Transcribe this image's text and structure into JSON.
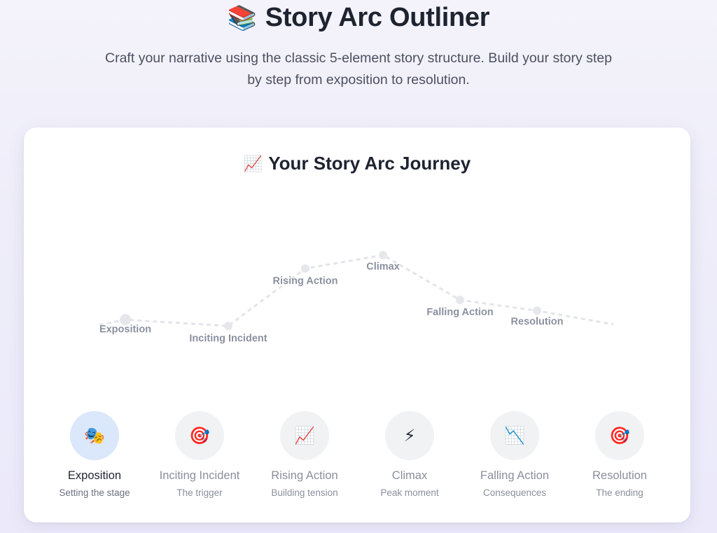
{
  "header": {
    "icon": "books-icon",
    "icon_glyph": "📚",
    "title": "Story Arc Outliner",
    "subtitle": "Craft your narrative using the classic 5-element story structure. Build your story step by step from exposition to resolution."
  },
  "journey": {
    "icon_glyph": "📈",
    "title": "Your Story Arc Journey"
  },
  "arc_points": [
    {
      "label": "Exposition",
      "tension": 0.2
    },
    {
      "label": "Inciting Incident",
      "tension": 0.13
    },
    {
      "label": "Rising Action",
      "tension": 0.77
    },
    {
      "label": "Climax",
      "tension": 0.92
    },
    {
      "label": "Falling Action",
      "tension": 0.42
    },
    {
      "label": "Resolution",
      "tension": 0.3
    }
  ],
  "steps": [
    {
      "icon": "theater-masks-icon",
      "glyph": "🎭",
      "title": "Exposition",
      "subtitle": "Setting the stage",
      "active": true
    },
    {
      "icon": "target-icon",
      "glyph": "🎯",
      "title": "Inciting Incident",
      "subtitle": "The trigger",
      "active": false
    },
    {
      "icon": "chart-up-icon",
      "glyph": "📈",
      "title": "Rising Action",
      "subtitle": "Building tension",
      "active": false
    },
    {
      "icon": "lightning-icon",
      "glyph": "⚡",
      "title": "Climax",
      "subtitle": "Peak moment",
      "active": false
    },
    {
      "icon": "chart-down-icon",
      "glyph": "📉",
      "title": "Falling Action",
      "subtitle": "Consequences",
      "active": false
    },
    {
      "icon": "target-icon",
      "glyph": "🎯",
      "title": "Resolution",
      "subtitle": "The ending",
      "active": false
    }
  ],
  "colors": {
    "active_step_bg": "#dbe7fb",
    "arc_line": "#e3e5ea",
    "arc_point": "#e6e7eb"
  }
}
